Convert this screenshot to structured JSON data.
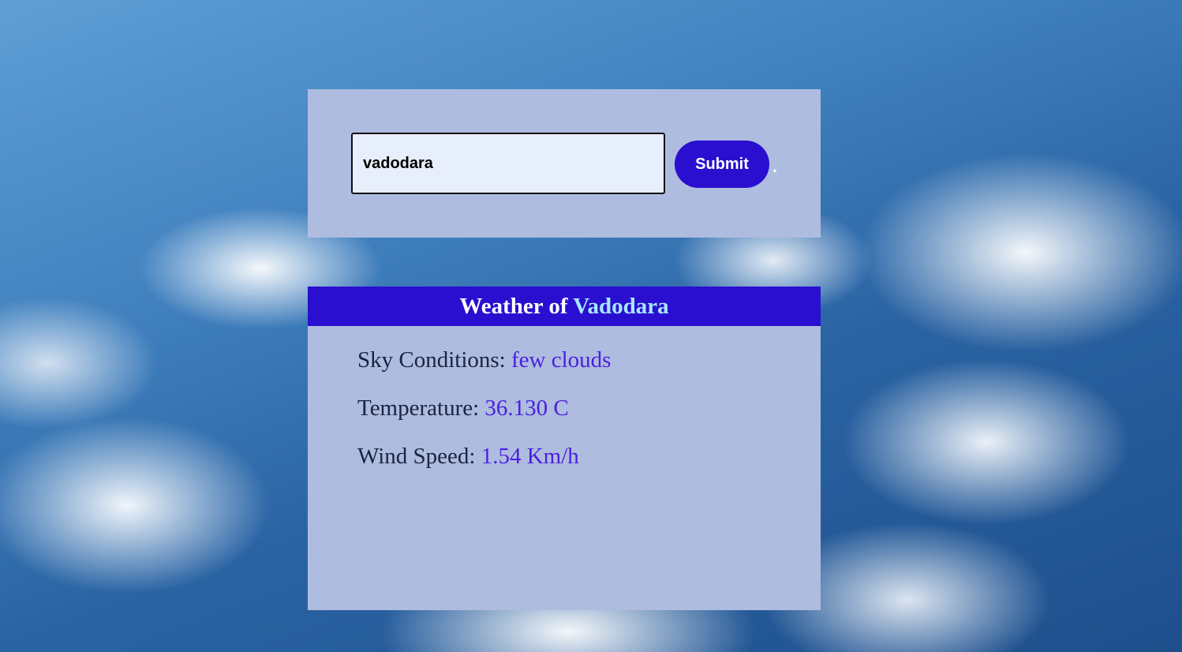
{
  "search": {
    "value": "vadodara",
    "submit_label": "Submit",
    "trailing_dot": "."
  },
  "weather": {
    "title_prefix": "Weather of",
    "city": "Vadodara",
    "sky_label": "Sky Conditions:",
    "sky_value": "few clouds",
    "temperature_label": "Temperature:",
    "temperature_value": "36.130 C",
    "wind_label": "Wind Speed:",
    "wind_value": "1.54 Km/h"
  },
  "colors": {
    "panel_bg": "#aebcdf",
    "accent": "#2a0fd0",
    "city_highlight": "#a8e8ff",
    "value_text": "#4a1fe0"
  }
}
